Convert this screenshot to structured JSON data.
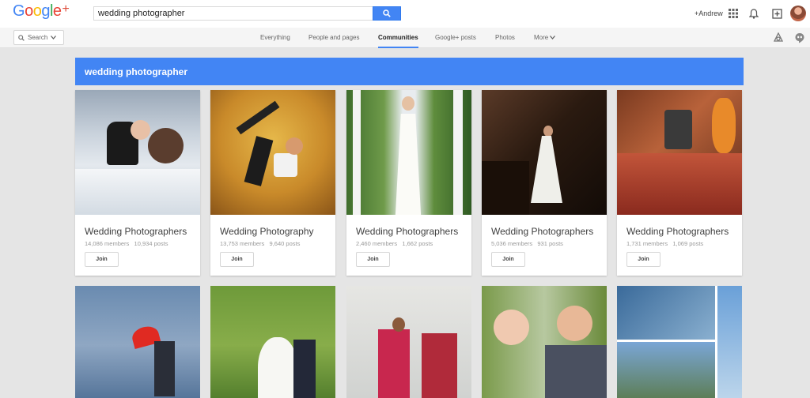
{
  "header": {
    "logo_text": "Google",
    "logo_plus": "+",
    "search_value": "wedding photographer",
    "user_name": "+Andrew",
    "icons": [
      "search-icon",
      "apps-icon",
      "bell-icon",
      "share-icon",
      "avatar"
    ]
  },
  "subbar": {
    "search_dropdown": "Search",
    "tabs": [
      "Everything",
      "People and pages",
      "Communities",
      "Google+ posts",
      "Photos",
      "More"
    ],
    "active_tab": "Communities"
  },
  "results": {
    "query_title": "wedding photographer",
    "communities": [
      {
        "name": "Wedding Photographers",
        "members": "14,086 members",
        "posts": "10,934 posts",
        "join": "Join"
      },
      {
        "name": "Wedding Photography",
        "members": "13,753 members",
        "posts": "9,640 posts",
        "join": "Join"
      },
      {
        "name": "Wedding Photographers",
        "members": "2,460 members",
        "posts": "1,662 posts",
        "join": "Join"
      },
      {
        "name": "Wedding Photographers",
        "members": "5,036 members",
        "posts": "931 posts",
        "join": "Join"
      },
      {
        "name": "Wedding Photographers",
        "members": "1,731 members",
        "posts": "1,069 posts",
        "join": "Join"
      }
    ]
  },
  "colors": {
    "accent": "#4285f4",
    "banner": "#4285f4",
    "background": "#e5e5e5"
  }
}
